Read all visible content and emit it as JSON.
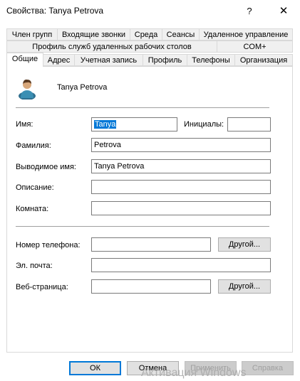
{
  "window": {
    "title": "Свойства: Tanya Petrova",
    "help_glyph": "?",
    "close_glyph": "✕"
  },
  "tabs_row1": [
    "Член групп",
    "Входящие звонки",
    "Среда",
    "Сеансы",
    "Удаленное управление"
  ],
  "tabs_row2": [
    "Профиль служб удаленных рабочих столов",
    "COM+"
  ],
  "tabs_row3": [
    "Общие",
    "Адрес",
    "Учетная запись",
    "Профиль",
    "Телефоны",
    "Организация"
  ],
  "active_tab": "Общие",
  "user": {
    "display": "Tanya Petrova",
    "icon": "user-icon"
  },
  "form": {
    "first_name_label": "Имя:",
    "first_name_value": "Tanya",
    "initials_label": "Инициалы:",
    "initials_value": "",
    "last_name_label": "Фамилия:",
    "last_name_value": "Petrova",
    "display_name_label": "Выводимое имя:",
    "display_name_value": "Tanya Petrova",
    "description_label": "Описание:",
    "description_value": "",
    "office_label": "Комната:",
    "office_value": "",
    "phone_label": "Номер телефона:",
    "phone_value": "",
    "email_label": "Эл. почта:",
    "email_value": "",
    "web_label": "Веб-страница:",
    "web_value": "",
    "other_button": "Другой..."
  },
  "buttons": {
    "ok": "ОК",
    "cancel": "Отмена",
    "apply": "Применить",
    "help": "Справка"
  },
  "watermark": "Активация Windows"
}
